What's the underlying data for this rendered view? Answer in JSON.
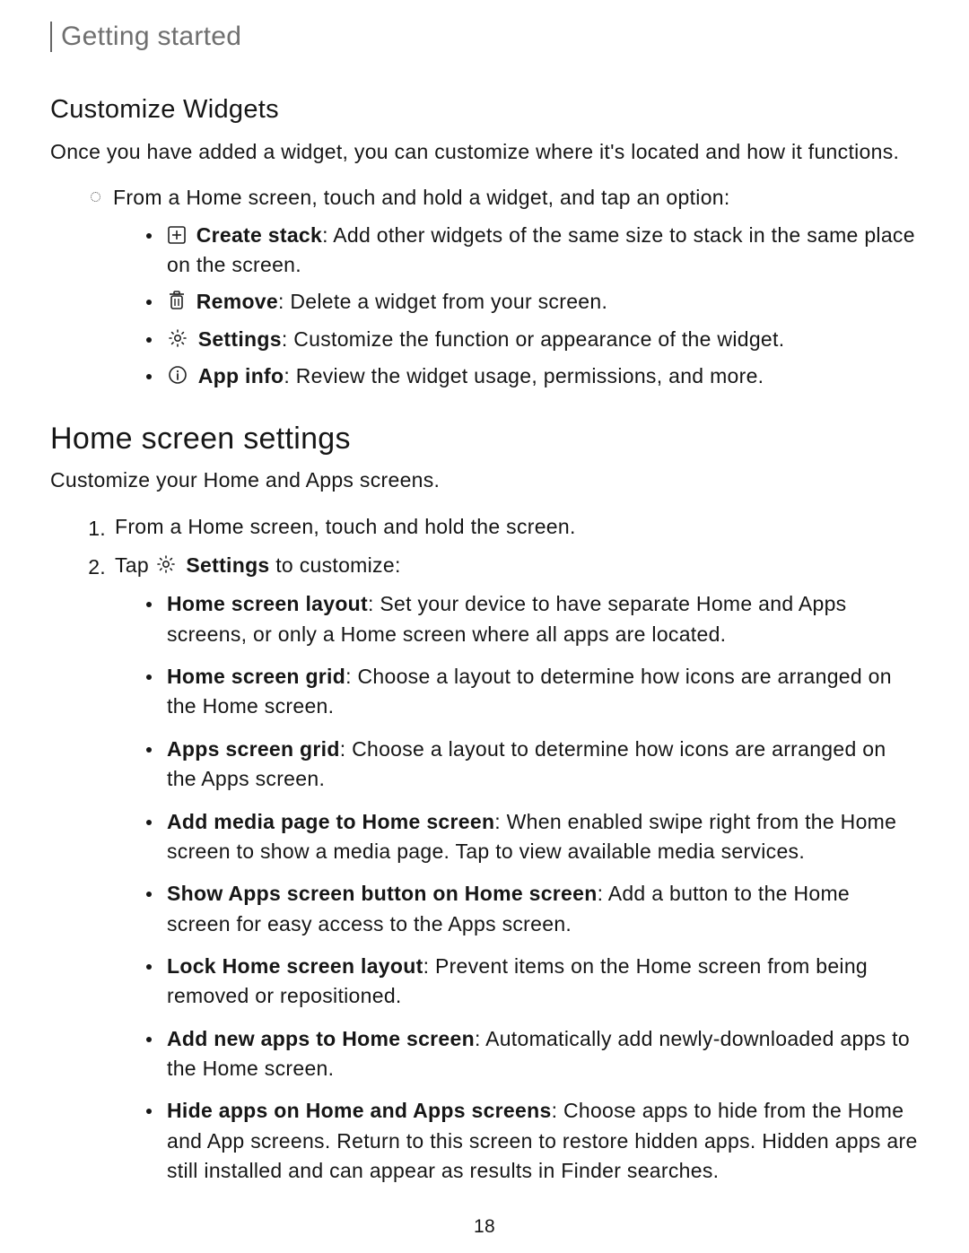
{
  "breadcrumb": "Getting started",
  "section1": {
    "title": "Customize Widgets",
    "intro": "Once you have added a widget, you can customize where it's located and how it functions.",
    "lead": "From a Home screen, touch and hold a widget, and tap an option:",
    "items": [
      {
        "icon": "create-stack-icon",
        "label": "Create stack",
        "desc": ": Add other widgets of the same size to stack in the same place on the screen."
      },
      {
        "icon": "remove-icon",
        "label": "Remove",
        "desc": ": Delete a widget from your screen."
      },
      {
        "icon": "settings-icon",
        "label": "Settings",
        "desc": ": Customize the function or appearance of the widget."
      },
      {
        "icon": "app-info-icon",
        "label": "App info",
        "desc": ": Review the widget usage, permissions, and more."
      }
    ]
  },
  "section2": {
    "title": "Home screen settings",
    "intro": "Customize your Home and Apps screens.",
    "step1": "From a Home screen, touch and hold the screen.",
    "step2_pre": "Tap",
    "step2_label": "Settings",
    "step2_post": "to customize:",
    "items": [
      {
        "label": "Home screen layout",
        "desc": ": Set your device to have separate Home and Apps screens, or only a Home screen where all apps are located."
      },
      {
        "label": "Home screen grid",
        "desc": ": Choose a layout to determine how icons are arranged on the Home screen."
      },
      {
        "label": "Apps screen grid",
        "desc": ": Choose a layout to determine how icons are arranged on the Apps screen."
      },
      {
        "label": "Add media page to Home screen",
        "desc": ": When enabled swipe right from the Home screen to show a media page. Tap to view available media services."
      },
      {
        "label": "Show Apps screen button on Home screen",
        "desc": ": Add a button to the Home screen for easy access to the Apps screen."
      },
      {
        "label": "Lock Home screen layout",
        "desc": ": Prevent items on the Home screen from being removed or repositioned."
      },
      {
        "label": "Add new apps to Home screen",
        "desc": ": Automatically add newly-downloaded apps to the Home screen."
      },
      {
        "label": "Hide apps on Home and Apps screens",
        "desc": ": Choose apps to hide from the Home and App screens. Return to this screen to restore hidden apps. Hidden apps are still installed and can appear as results in Finder searches."
      }
    ]
  },
  "page_number": "18",
  "numbers": {
    "one": "1.",
    "two": "2."
  }
}
